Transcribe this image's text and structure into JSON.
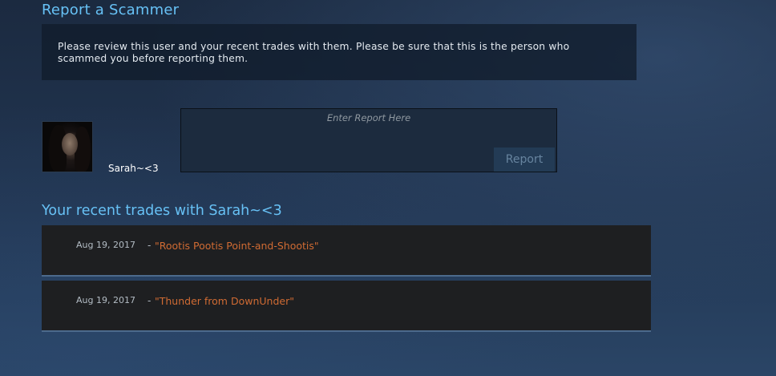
{
  "page": {
    "heading": "Report a Scammer",
    "notice": "Please review this user and your recent trades with them. Please be sure that this is the person who scammed you before reporting them."
  },
  "user": {
    "name": "Sarah~<3"
  },
  "report": {
    "placeholder": "Enter Report Here",
    "value": "",
    "button_label": "Report"
  },
  "trades": {
    "heading": "Your recent trades with Sarah~<3",
    "separator": "-",
    "rows": [
      {
        "date": "Aug 19, 2017",
        "item": "\"Rootis Pootis Point-and-Shootis\""
      },
      {
        "date": "Aug 19, 2017",
        "item": "\"Thunder from DownUnder\""
      }
    ]
  },
  "colors": {
    "heading_blue": "#67c1f5",
    "item_orange": "#d06b33",
    "row_bg": "#1e1f21",
    "button_bg": "#233b55"
  }
}
